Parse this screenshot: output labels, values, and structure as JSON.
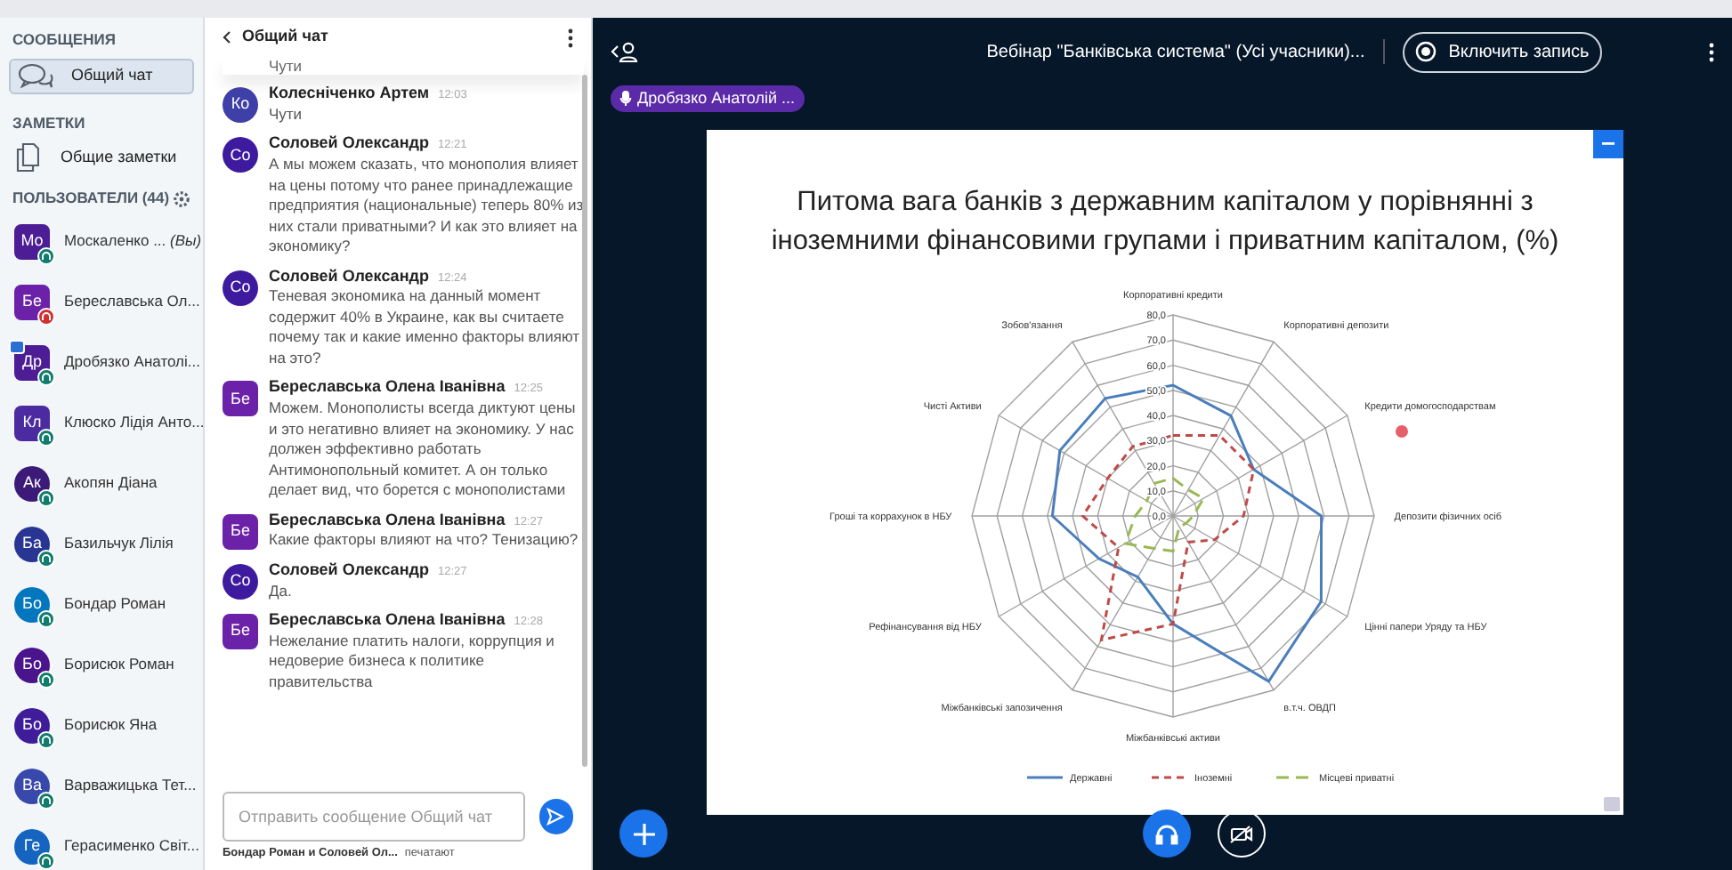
{
  "sidebar": {
    "messages_heading": "СООБЩЕНИЯ",
    "chat_item": {
      "label": "Общий чат",
      "selected": true
    },
    "notes_heading": "ЗАМЕТКИ",
    "notes_item": {
      "label": "Общие заметки"
    },
    "users_heading": "ПОЛЬЗОВАТЕЛИ (44)",
    "users": [
      {
        "initials": "Мо",
        "name": "Москаленко ...",
        "suffix": "(Вы)",
        "kind": "moderator",
        "color": "#4c1d95",
        "muted": false,
        "presenter": false
      },
      {
        "initials": "Бе",
        "name": "Береславська Ол...",
        "kind": "moderator",
        "color": "#6b21a8",
        "muted": true,
        "presenter": false
      },
      {
        "initials": "Др",
        "name": "Дробязко Анатолі...",
        "kind": "moderator",
        "color": "#4c1d95",
        "muted": false,
        "presenter": true
      },
      {
        "initials": "Кл",
        "name": "Клюско Лідія Анто...",
        "kind": "moderator",
        "color": "#4c2ba0",
        "muted": false,
        "presenter": false
      },
      {
        "initials": "Ак",
        "name": "Акопян Діана",
        "kind": "viewer",
        "color": "#3b1a78",
        "muted": false,
        "presenter": false
      },
      {
        "initials": "Ба",
        "name": "Базильчук Лілія",
        "kind": "viewer",
        "color": "#283593",
        "muted": false,
        "presenter": false
      },
      {
        "initials": "Бо",
        "name": "Бондар Роман",
        "kind": "viewer",
        "color": "#0277bd",
        "muted": false,
        "presenter": false
      },
      {
        "initials": "Бо",
        "name": "Борисюк Роман",
        "kind": "viewer",
        "color": "#4a148c",
        "muted": false,
        "presenter": false
      },
      {
        "initials": "Бо",
        "name": "Борисюк Яна",
        "kind": "viewer",
        "color": "#3f1d9a",
        "muted": false,
        "presenter": false
      },
      {
        "initials": "Ва",
        "name": "Варважицька Тет...",
        "kind": "viewer",
        "color": "#3949ab",
        "muted": false,
        "presenter": false
      },
      {
        "initials": "Ге",
        "name": "Герасименко Світ...",
        "kind": "viewer",
        "color": "#1565c0",
        "muted": false,
        "presenter": false
      }
    ]
  },
  "chat": {
    "title": "Общий чат",
    "partial_message": "Чути",
    "messages": [
      {
        "initials": "Ко",
        "author": "Колесніченко Артем",
        "time": "12:03",
        "text": "Чути",
        "kind": "viewer",
        "color": "#3f3fa8"
      },
      {
        "initials": "Со",
        "author": "Соловей Олександр",
        "time": "12:21",
        "text": "А мы можем сказать, что монополия влияет на цены потому что ранее принадлежащие предприятия (национальные) теперь 80% из них стали приватными? И как это влияет на экономику?",
        "kind": "viewer",
        "color": "#3d1a9e"
      },
      {
        "initials": "Со",
        "author": "Соловей Олександр",
        "time": "12:24",
        "text": "Теневая экономика на данный момент содержит 40% в Украине, как вы считаете почему так и какие именно факторы влияют на это?",
        "kind": "viewer",
        "color": "#3d1a9e"
      },
      {
        "initials": "Бе",
        "author": "Береславська Олена Іванівна",
        "time": "12:25",
        "text": "Можем. Монополисты всегда диктуют цены и это негативно влияет на экономику. У нас должен эффективно работать Антимонопольный комитет. А он только делает вид, что борется с монополистами",
        "kind": "moderator",
        "color": "#6b21a8"
      },
      {
        "initials": "Бе",
        "author": "Береславська Олена Іванівна",
        "time": "12:27",
        "text": "Какие факторы влияют на что? Тенизацию?",
        "kind": "moderator",
        "color": "#6b21a8"
      },
      {
        "initials": "Со",
        "author": "Соловей Олександр",
        "time": "12:27",
        "text": "Да.",
        "kind": "viewer",
        "color": "#3d1a9e"
      },
      {
        "initials": "Бе",
        "author": "Береславська Олена Іванівна",
        "time": "12:28",
        "text": "Нежелание платить налоги, коррупция и недоверие бизнеса к политике правительства",
        "kind": "moderator",
        "color": "#6b21a8"
      }
    ],
    "input": {
      "placeholder": "Отправить сообщение Общий чат"
    },
    "typing_names": "Бондар Роман и Соловей Ол...",
    "typing_label": "печатают"
  },
  "topbar": {
    "title": "Вебінар \"Банківська система\" (Усі учасники)...",
    "record_button": "Включить запись",
    "presenter": "Дробязко Анатолій ..."
  },
  "slide": {
    "title": "Питома вага банків з державним капіталом у порівнянні з іноземними фінансовими групами і приватним капіталом, (%)",
    "chart_data": {
      "type": "radar",
      "categories": [
        "Корпоративні кредити",
        "Корпоративні депозити",
        "Кредити домогосподарствам",
        "Депозити фізичних осіб",
        "Цінні папери Уряду та НБУ",
        "в.т.ч. ОВДП",
        "Міжбанківські активи",
        "Міжбанківські запозичення",
        "Рефінансування від НБУ",
        "Гроші та коррахунок в НБУ",
        "Чисті Активи",
        "Зобов'язання"
      ],
      "ylim": [
        0,
        80
      ],
      "legend": "bottom",
      "yticks": [
        {
          "value": 0,
          "label": "0,0"
        },
        {
          "value": 10,
          "label": "10,0"
        },
        {
          "value": 20,
          "label": "20,0"
        },
        {
          "value": 30,
          "label": "30,0"
        },
        {
          "value": 40,
          "label": "40,0"
        },
        {
          "value": 50,
          "label": "50,0"
        },
        {
          "value": 60,
          "label": "60,0"
        },
        {
          "value": 70,
          "label": "70,0"
        },
        {
          "value": 80,
          "label": "80,0"
        }
      ],
      "series": [
        {
          "name": "Державні",
          "color": "#4a7ebb",
          "values": [
            52,
            46,
            37,
            59,
            68,
            76,
            43,
            28,
            34,
            48,
            52,
            54
          ]
        },
        {
          "name": "Іноземні",
          "color": "#be4b48",
          "values": [
            32,
            37,
            37,
            28,
            19,
            12,
            43,
            57,
            25,
            36,
            30,
            32
          ]
        },
        {
          "name": "Місцеві приватні",
          "color": "#98b954",
          "values": [
            15,
            12,
            14,
            8,
            6,
            5,
            14,
            15,
            22,
            15,
            12,
            15
          ]
        }
      ]
    }
  }
}
